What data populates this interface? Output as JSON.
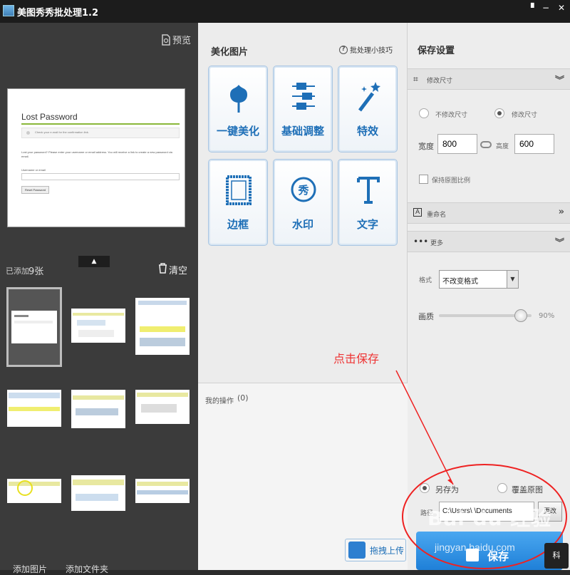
{
  "window": {
    "title": "美图秀秀批处理1.2",
    "pin_icon": "pin-icon",
    "minimize_glyph": "−",
    "close_glyph": "✕"
  },
  "left_panel": {
    "preview_label": "预览",
    "preview_page": {
      "title": "Lost Password",
      "notice": "Check your e-mail for the confirmation link.",
      "body": "Lost your password? Please enter your username or email address. You will receive a link to create a new password via email.",
      "field_label": "Username or email",
      "button": "Reset Password"
    },
    "collapse_glyph": "▲",
    "added_label": "已添加",
    "added_count": "9张",
    "clear_label": "清空",
    "thumbnails_count": 9,
    "bottom_add_image": "添加图片",
    "bottom_add_folder": "添加文件夹"
  },
  "middle_panel": {
    "title": "美化图片",
    "tips_label": "批处理小技巧",
    "tools": [
      {
        "label": "一键美化",
        "icon": "tulip-icon"
      },
      {
        "label": "基础调整",
        "icon": "sliders-icon"
      },
      {
        "label": "特效",
        "icon": "magic-wand-icon"
      },
      {
        "label": "边框",
        "icon": "frame-icon"
      },
      {
        "label": "水印",
        "icon": "watermark-icon"
      },
      {
        "label": "文字",
        "icon": "text-icon"
      }
    ],
    "ops_label": "我的操作",
    "ops_count": "(0)",
    "annotation": "点击保存",
    "upload_label": "拖拽上传"
  },
  "right_panel": {
    "title": "保存设置",
    "resize_section": "修改尺寸",
    "no_resize": "不修改尺寸",
    "resize": "修改尺寸",
    "width_label": "宽度",
    "width_value": "800",
    "height_label": "高度",
    "height_value": "600",
    "keep_ratio": "保持原图比例",
    "rename_section": "重命名",
    "more_section": "更多",
    "format_label": "格式",
    "format_value": "不改变格式",
    "quality_label": "画质",
    "quality_value": "90%",
    "quality_level": 0.9,
    "save_as": "另存为",
    "overwrite": "覆盖原图",
    "path_label": "路径",
    "path_value": "C:\\Users\\      \\Documents",
    "change_button": "更改",
    "save_button": "保存"
  },
  "overlay": {
    "watermark": "Bai du 经验",
    "watermark_sub": "jingyan.baidu.com",
    "badge": "科"
  },
  "colors": {
    "accent": "#1e6fb7",
    "annotation": "#e22222",
    "save_button": "#2a8ee0"
  }
}
